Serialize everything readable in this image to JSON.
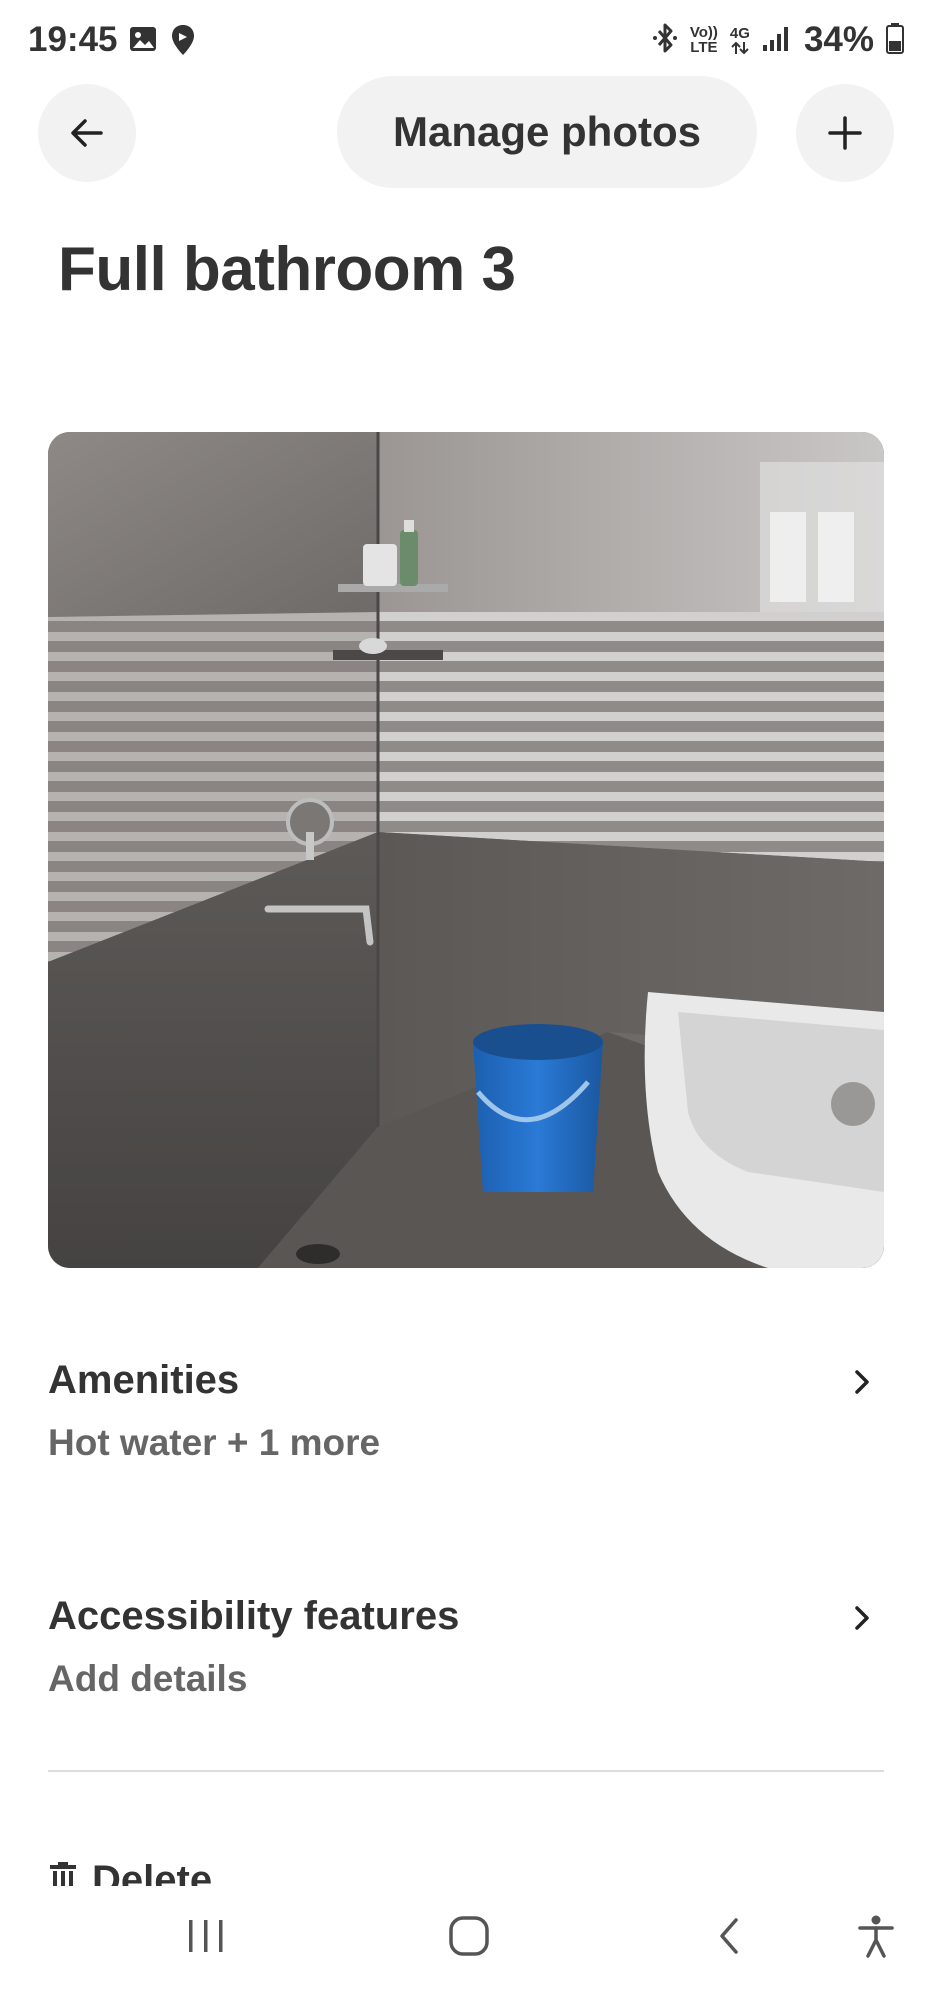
{
  "status_bar": {
    "time": "19:45",
    "network_volte_top": "Vo))",
    "network_volte_bottom": "LTE",
    "network_4g": "4G",
    "battery": "34%"
  },
  "header": {
    "back_icon": "arrow-left-icon",
    "title_button": "Manage photos",
    "add_icon": "plus-icon"
  },
  "page": {
    "title": "Full bathroom 3"
  },
  "rows": [
    {
      "title": "Amenities",
      "subtitle": "Hot water + 1 more"
    },
    {
      "title": "Accessibility features",
      "subtitle": "Add details"
    }
  ],
  "delete": {
    "label": "Delete",
    "icon": "trash-icon"
  },
  "colors": {
    "text_primary": "#333333",
    "text_secondary": "#666666",
    "button_bg": "#f2f2f2",
    "divider": "#dddddd"
  }
}
